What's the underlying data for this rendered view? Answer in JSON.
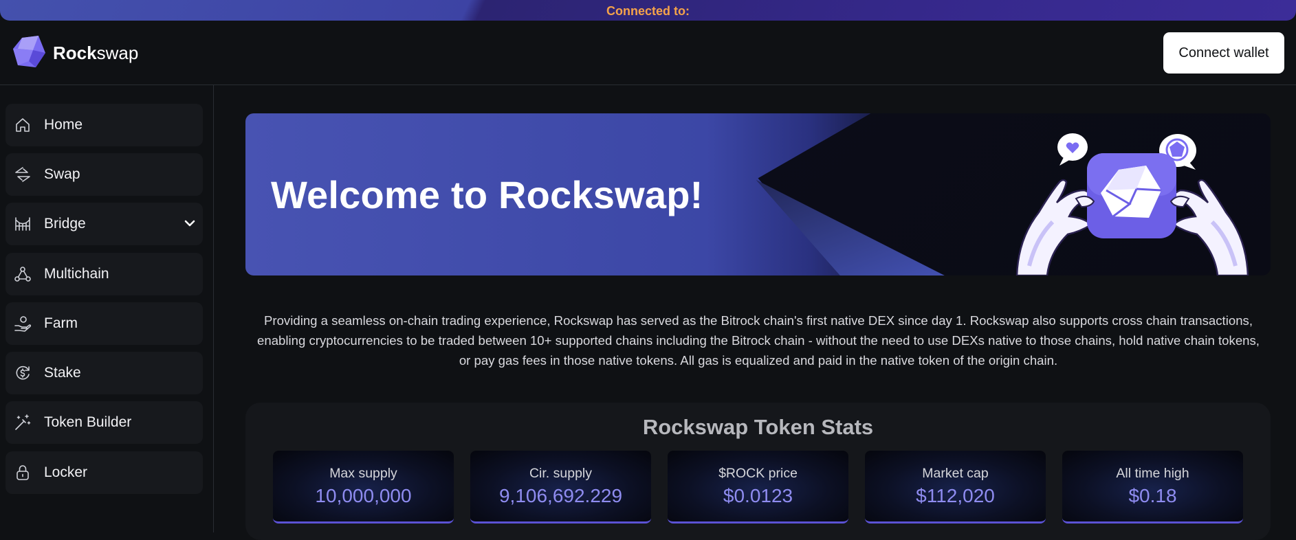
{
  "topbar": {
    "text": "Connected to:"
  },
  "header": {
    "brand_bold": "Rock",
    "brand_rest": "swap",
    "connect_label": "Connect wallet"
  },
  "sidebar": {
    "items": [
      {
        "label": "Home",
        "icon": "home-icon"
      },
      {
        "label": "Swap",
        "icon": "swap-arrows-icon"
      },
      {
        "label": "Bridge",
        "icon": "bridge-icon",
        "expandable": true
      },
      {
        "label": "Multichain",
        "icon": "network-icon"
      },
      {
        "label": "Farm",
        "icon": "hand-coin-icon"
      },
      {
        "label": "Stake",
        "icon": "dollar-cycle-icon"
      },
      {
        "label": "Token Builder",
        "icon": "magic-wand-icon"
      },
      {
        "label": "Locker",
        "icon": "lock-icon"
      }
    ]
  },
  "hero": {
    "title": "Welcome to Rockswap!"
  },
  "description": "Providing a seamless on-chain trading experience, Rockswap has served as the Bitrock chain's first native DEX since day 1. Rockswap also supports cross chain transactions, enabling cryptocurrencies to be traded between 10+ supported chains including the Bitrock chain - without the need to use DEXs native to those chains, hold native chain tokens, or pay gas fees in those native tokens. All gas is equalized and paid in the native token of the origin chain.",
  "stats": {
    "title": "Rockswap Token Stats",
    "cards": [
      {
        "label": "Max supply",
        "value": "10,000,000"
      },
      {
        "label": "Cir. supply",
        "value": "9,106,692.229"
      },
      {
        "label": "$ROCK price",
        "value": "$0.0123"
      },
      {
        "label": "Market cap",
        "value": "$112,020"
      },
      {
        "label": "All time high",
        "value": "$0.18"
      }
    ]
  },
  "colors": {
    "accent": "#6c63f0",
    "connected_text": "#f5a34a",
    "stat_value": "#8f8cf0"
  }
}
